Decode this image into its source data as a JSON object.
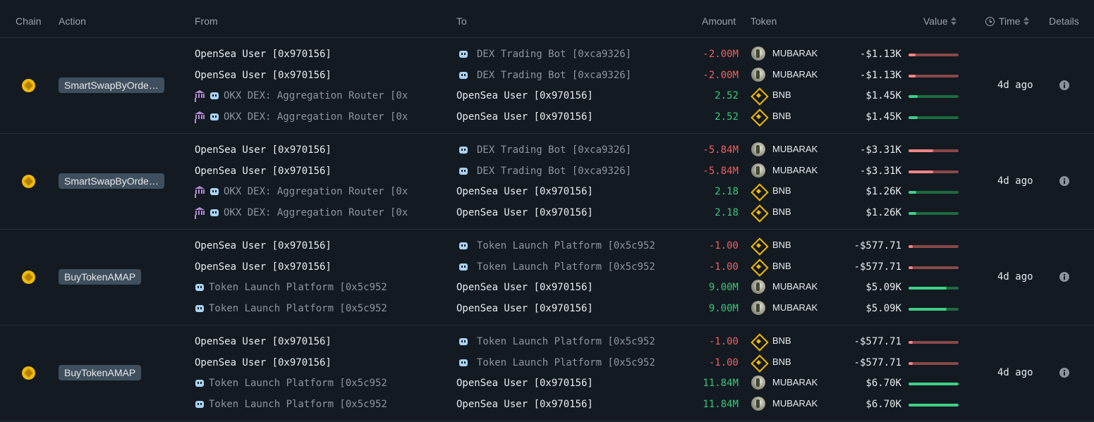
{
  "header": {
    "chain": "Chain",
    "action": "Action",
    "from": "From",
    "to": "To",
    "amount": "Amount",
    "token": "Token",
    "value": "Value",
    "time": "Time",
    "details": "Details"
  },
  "colors": {
    "background": "#131a22",
    "negative": "#ef6161",
    "positive": "#3ec77a",
    "badge": "#3f4f5e",
    "bnb": "#f0b90b"
  },
  "groups": [
    {
      "action": "SmartSwapByOrderId",
      "time": "4d ago",
      "rows": [
        {
          "from": "OpenSea User [0x970156]",
          "to": "DEX Trading Bot [0xca9326]",
          "amount": "-2.00M",
          "token": "MUBARAK",
          "value": "-$1.13K",
          "bar": 0.14
        },
        {
          "from": "OpenSea User [0x970156]",
          "to": "DEX Trading Bot [0xca9326]",
          "amount": "-2.00M",
          "token": "MUBARAK",
          "value": "-$1.13K",
          "bar": 0.14
        },
        {
          "from": "OKX DEX: Aggregation Router [0x",
          "to": "OpenSea User [0x970156]",
          "amount": "2.52",
          "token": "BNB",
          "value": "$1.45K",
          "bar": 0.18
        },
        {
          "from": "OKX DEX: Aggregation Router [0x",
          "to": "OpenSea User [0x970156]",
          "amount": "2.52",
          "token": "BNB",
          "value": "$1.45K",
          "bar": 0.18
        }
      ]
    },
    {
      "action": "SmartSwapByOrderId",
      "time": "4d ago",
      "rows": [
        {
          "from": "OpenSea User [0x970156]",
          "to": "DEX Trading Bot [0xca9326]",
          "amount": "-5.84M",
          "token": "MUBARAK",
          "value": "-$3.31K",
          "bar": 0.49
        },
        {
          "from": "OpenSea User [0x970156]",
          "to": "DEX Trading Bot [0xca9326]",
          "amount": "-5.84M",
          "token": "MUBARAK",
          "value": "-$3.31K",
          "bar": 0.49
        },
        {
          "from": "OKX DEX: Aggregation Router [0x",
          "to": "OpenSea User [0x970156]",
          "amount": "2.18",
          "token": "BNB",
          "value": "$1.26K",
          "bar": 0.16
        },
        {
          "from": "OKX DEX: Aggregation Router [0x",
          "to": "OpenSea User [0x970156]",
          "amount": "2.18",
          "token": "BNB",
          "value": "$1.26K",
          "bar": 0.16
        }
      ]
    },
    {
      "action": "BuyTokenAMAP",
      "time": "4d ago",
      "rows": [
        {
          "from": "OpenSea User [0x970156]",
          "to": "Token Launch Platform [0x5c952",
          "amount": "-1.00",
          "token": "BNB",
          "value": "-$577.71",
          "bar": 0.09
        },
        {
          "from": "OpenSea User [0x970156]",
          "to": "Token Launch Platform [0x5c952",
          "amount": "-1.00",
          "token": "BNB",
          "value": "-$577.71",
          "bar": 0.09
        },
        {
          "from": "Token Launch Platform [0x5c952",
          "to": "OpenSea User [0x970156]",
          "amount": "9.00M",
          "token": "MUBARAK",
          "value": "$5.09K",
          "bar": 0.76
        },
        {
          "from": "Token Launch Platform [0x5c952",
          "to": "OpenSea User [0x970156]",
          "amount": "9.00M",
          "token": "MUBARAK",
          "value": "$5.09K",
          "bar": 0.76
        }
      ]
    },
    {
      "action": "BuyTokenAMAP",
      "time": "4d ago",
      "rows": [
        {
          "from": "OpenSea User [0x970156]",
          "to": "Token Launch Platform [0x5c952",
          "amount": "-1.00",
          "token": "BNB",
          "value": "-$577.71",
          "bar": 0.09
        },
        {
          "from": "OpenSea User [0x970156]",
          "to": "Token Launch Platform [0x5c952",
          "amount": "-1.00",
          "token": "BNB",
          "value": "-$577.71",
          "bar": 0.09
        },
        {
          "from": "Token Launch Platform [0x5c952",
          "to": "OpenSea User [0x970156]",
          "amount": "11.84M",
          "token": "MUBARAK",
          "value": "$6.70K",
          "bar": 1.0
        },
        {
          "from": "Token Launch Platform [0x5c952",
          "to": "OpenSea User [0x970156]",
          "amount": "11.84M",
          "token": "MUBARAK",
          "value": "$6.70K",
          "bar": 1.0
        }
      ]
    }
  ]
}
